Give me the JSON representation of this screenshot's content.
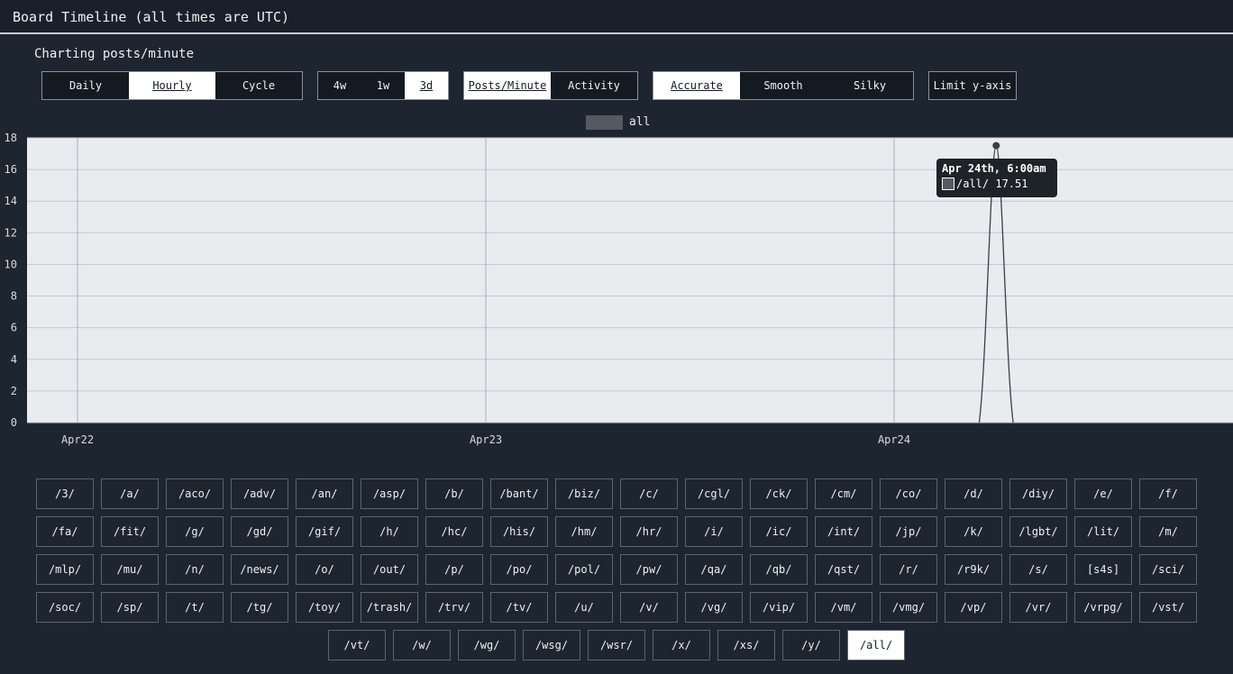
{
  "header": {
    "title": "Board Timeline (all times are UTC)"
  },
  "subtitle": "Charting posts/minute",
  "controls": {
    "mode": [
      {
        "label": "Daily",
        "active": false
      },
      {
        "label": "Hourly",
        "active": true
      },
      {
        "label": "Cycle",
        "active": false
      }
    ],
    "range": [
      {
        "label": "4w",
        "active": false
      },
      {
        "label": "1w",
        "active": false
      },
      {
        "label": "3d",
        "active": true
      }
    ],
    "metric": [
      {
        "label": "Posts/Minute",
        "active": true
      },
      {
        "label": "Activity",
        "active": false
      }
    ],
    "smoothing": [
      {
        "label": "Accurate",
        "active": true
      },
      {
        "label": "Smooth",
        "active": false
      },
      {
        "label": "Silky",
        "active": false
      }
    ],
    "limit_label": "Limit y-axis"
  },
  "legend": {
    "label": "all",
    "color": "#555a60"
  },
  "tooltip": {
    "title": "Apr 24th, 6:00am",
    "series": "/all/",
    "value": "17.51"
  },
  "chart_data": {
    "type": "line",
    "ylim": [
      0,
      18
    ],
    "yticks": [
      0,
      2,
      4,
      6,
      8,
      10,
      12,
      14,
      16,
      18
    ],
    "xticks": [
      "Apr22",
      "Apr23",
      "Apr24"
    ],
    "grid": true,
    "series": [
      {
        "name": "all",
        "color": "#555a60",
        "x": [
          "Apr 24 05:00",
          "Apr 24 06:00",
          "Apr 24 07:00"
        ],
        "values": [
          0,
          17.51,
          0
        ]
      }
    ]
  },
  "boards": [
    [
      "/3/",
      "/a/",
      "/aco/",
      "/adv/",
      "/an/",
      "/asp/",
      "/b/",
      "/bant/",
      "/biz/",
      "/c/",
      "/cgl/",
      "/ck/",
      "/cm/",
      "/co/",
      "/d/",
      "/diy/",
      "/e/",
      "/f/"
    ],
    [
      "/fa/",
      "/fit/",
      "/g/",
      "/gd/",
      "/gif/",
      "/h/",
      "/hc/",
      "/his/",
      "/hm/",
      "/hr/",
      "/i/",
      "/ic/",
      "/int/",
      "/jp/",
      "/k/",
      "/lgbt/",
      "/lit/",
      "/m/"
    ],
    [
      "/mlp/",
      "/mu/",
      "/n/",
      "/news/",
      "/o/",
      "/out/",
      "/p/",
      "/po/",
      "/pol/",
      "/pw/",
      "/qa/",
      "/qb/",
      "/qst/",
      "/r/",
      "/r9k/",
      "/s/",
      "[s4s]",
      "/sci/"
    ],
    [
      "/soc/",
      "/sp/",
      "/t/",
      "/tg/",
      "/toy/",
      "/trash/",
      "/trv/",
      "/tv/",
      "/u/",
      "/v/",
      "/vg/",
      "/vip/",
      "/vm/",
      "/vmg/",
      "/vp/",
      "/vr/",
      "/vrpg/",
      "/vst/"
    ],
    [
      "/vt/",
      "/w/",
      "/wg/",
      "/wsg/",
      "/wsr/",
      "/x/",
      "/xs/",
      "/y/",
      "/all/"
    ]
  ],
  "active_board": "/all/"
}
